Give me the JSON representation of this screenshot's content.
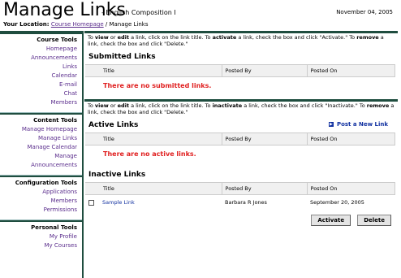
{
  "header": {
    "title": "Manage Links",
    "course": "- English Composition I",
    "date": "November 04, 2005",
    "location_label": "Your Location:",
    "breadcrumb_link": "Course Homepage",
    "breadcrumb_sep": " / ",
    "breadcrumb_current": "Manage Links"
  },
  "sidebar": {
    "sections": [
      {
        "title": "Course Tools",
        "items": [
          "Homepage",
          "Announcements",
          "Links",
          "Calendar",
          "E-mail",
          "Chat",
          "Members"
        ]
      },
      {
        "title": "Content Tools",
        "items": [
          "Manage Homepage",
          "Manage Links",
          "Manage Calendar",
          "Manage",
          "Announcements"
        ]
      },
      {
        "title": "Configuration Tools",
        "items": [
          "Applications",
          "Members",
          "Permissions"
        ]
      },
      {
        "title": "Personal Tools",
        "items": [
          "My Profile",
          "My Courses"
        ]
      }
    ]
  },
  "submitted": {
    "instr": [
      {
        "t": "To "
      },
      {
        "t": "view",
        "b": true
      },
      {
        "t": " or "
      },
      {
        "t": "edit",
        "b": true
      },
      {
        "t": " a link, click on the link title.  To "
      },
      {
        "t": "activate",
        "b": true
      },
      {
        "t": " a link, check the box and click \"Activate.\"  To "
      },
      {
        "t": "remove",
        "b": true
      },
      {
        "t": " a link, check the box and click \"Delete.\""
      }
    ],
    "title": "Submitted Links",
    "columns": [
      "Title",
      "Posted By",
      "Posted On"
    ],
    "empty": "There are no submitted links."
  },
  "active": {
    "instr": [
      {
        "t": "To "
      },
      {
        "t": "view",
        "b": true
      },
      {
        "t": " or "
      },
      {
        "t": "edit",
        "b": true
      },
      {
        "t": " a link, click on the link title.  To "
      },
      {
        "t": "inactivate",
        "b": true
      },
      {
        "t": " a link, check the box and click \"Inactivate.\"  To "
      },
      {
        "t": "remove",
        "b": true
      },
      {
        "t": " a link, check the box and click \"Delete.\""
      }
    ],
    "title": "Active Links",
    "post_new": "Post a New Link",
    "columns": [
      "Title",
      "Posted By",
      "Posted On"
    ],
    "empty": "There are no active links."
  },
  "inactive": {
    "title": "Inactive Links",
    "columns": [
      "Title",
      "Posted By",
      "Posted On"
    ],
    "rows": [
      {
        "title": "Sample Link",
        "posted_by": "Barbara R Jones",
        "posted_on": "September 20, 2005"
      }
    ]
  },
  "buttons": {
    "activate": "Activate",
    "delete": "Delete"
  }
}
